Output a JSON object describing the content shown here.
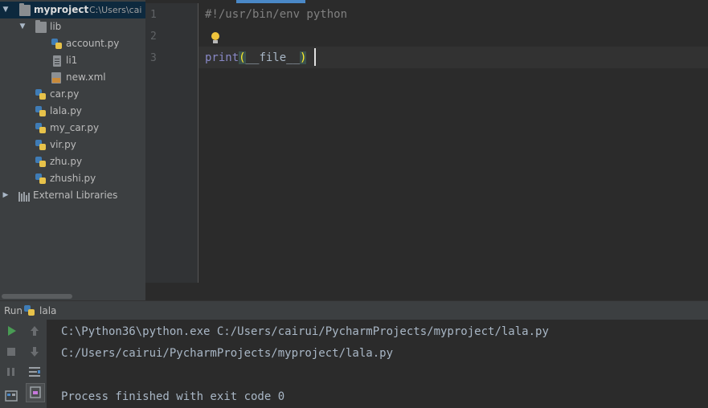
{
  "project_tree": {
    "root": {
      "name": "myproject",
      "path": "C:\\Users\\cai"
    },
    "items": [
      {
        "label": "lib",
        "type": "folder"
      },
      {
        "label": "account.py",
        "type": "python"
      },
      {
        "label": "li1",
        "type": "text"
      },
      {
        "label": "new.xml",
        "type": "xml"
      },
      {
        "label": "car.py",
        "type": "python"
      },
      {
        "label": "lala.py",
        "type": "python"
      },
      {
        "label": "my_car.py",
        "type": "python"
      },
      {
        "label": "vir.py",
        "type": "python"
      },
      {
        "label": "zhu.py",
        "type": "python"
      },
      {
        "label": "zhushi.py",
        "type": "python"
      }
    ],
    "external_libraries": "External Libraries"
  },
  "editor": {
    "line_numbers": [
      "1",
      "2",
      "3"
    ],
    "line1": "#!/usr/bin/env python",
    "line3": {
      "keyword": "print",
      "open_paren": "(",
      "arg": "__file__",
      "close_paren": ")"
    }
  },
  "run_panel": {
    "label": "Run",
    "config_name": "lala",
    "output": [
      "C:\\Python36\\python.exe C:/Users/cairui/PycharmProjects/myproject/lala.py",
      "C:/Users/cairui/PycharmProjects/myproject/lala.py",
      "",
      "Process finished with exit code 0"
    ]
  },
  "colors": {
    "panel_bg": "#3c3f41",
    "editor_bg": "#2b2b2b",
    "selection": "#0d293e",
    "run_green": "#499c54"
  }
}
